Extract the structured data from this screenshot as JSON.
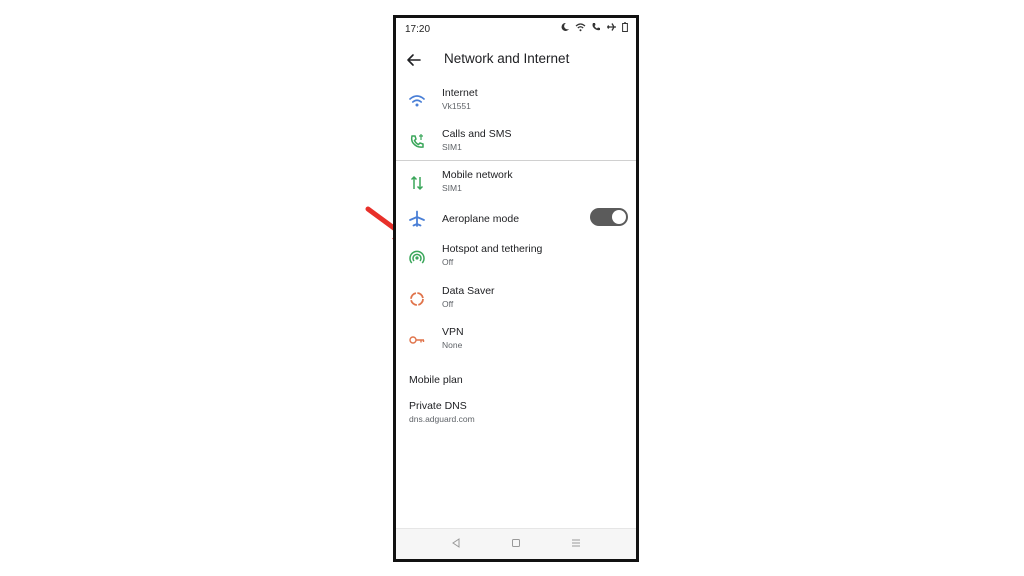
{
  "status_bar": {
    "time": "17:20"
  },
  "header": {
    "title": "Network and Internet"
  },
  "items": [
    {
      "key": "internet",
      "title": "Internet",
      "subtitle": "Vk1551",
      "icon": "wifi-icon",
      "color": "#4a7fd6"
    },
    {
      "key": "calls",
      "title": "Calls and SMS",
      "subtitle": "SIM1",
      "icon": "phone-icon",
      "color": "#3aa65a"
    },
    {
      "key": "mobile_network",
      "title": "Mobile network",
      "subtitle": "SIM1",
      "icon": "data-arrows-icon",
      "color": "#3aa65a"
    },
    {
      "key": "aeroplane",
      "title": "Aeroplane mode",
      "subtitle": "",
      "icon": "airplane-icon",
      "color": "#4a7fd6",
      "toggle_on": true
    },
    {
      "key": "hotspot",
      "title": "Hotspot and tethering",
      "subtitle": "Off",
      "icon": "hotspot-icon",
      "color": "#3aa65a"
    },
    {
      "key": "data_saver",
      "title": "Data Saver",
      "subtitle": "Off",
      "icon": "data-saver-icon",
      "color": "#e0734a"
    },
    {
      "key": "vpn",
      "title": "VPN",
      "subtitle": "None",
      "icon": "key-icon",
      "color": "#e0734a"
    },
    {
      "key": "mobile_plan",
      "title": "Mobile plan",
      "subtitle": ""
    },
    {
      "key": "private_dns",
      "title": "Private DNS",
      "subtitle": "dns.adguard.com"
    }
  ],
  "annotation": {
    "arrow_color": "#e8302a",
    "arrow_target": "hotspot"
  }
}
